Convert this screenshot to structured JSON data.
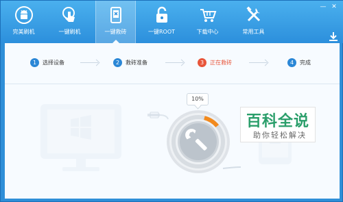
{
  "nav": {
    "items": [
      {
        "label": "完美刷机",
        "icon": "android-robot-icon"
      },
      {
        "label": "一键刷机",
        "icon": "tap-hand-icon"
      },
      {
        "label": "一键救砖",
        "icon": "phone-repair-icon",
        "active": true
      },
      {
        "label": "一键ROOT",
        "icon": "unlock-icon"
      },
      {
        "label": "下载中心",
        "icon": "shopping-cart-icon"
      },
      {
        "label": "常用工具",
        "icon": "tools-icon"
      }
    ]
  },
  "window": {
    "controls": [
      "minimize-icon",
      "close-icon"
    ]
  },
  "steps": [
    {
      "num": "1",
      "label": "选择设备"
    },
    {
      "num": "2",
      "label": "救砖准备"
    },
    {
      "num": "3",
      "label": "正在救砖",
      "current": true
    },
    {
      "num": "4",
      "label": "完成"
    }
  ],
  "progress": {
    "percent_label": "10%",
    "value": 0.1
  },
  "watermark": {
    "title": "百科全说",
    "subtitle": "助你轻松解决"
  },
  "colors": {
    "accent": "#2b87d6",
    "current_step": "#e8553a",
    "progress": "#f28a1e",
    "brand_watermark": "#2a9e6a"
  }
}
